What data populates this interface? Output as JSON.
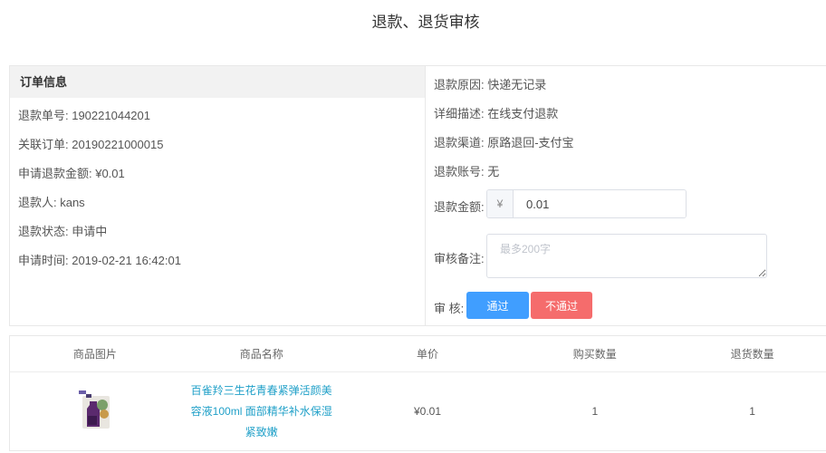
{
  "page": {
    "title": "退款、退货审核"
  },
  "order_info": {
    "header": "订单信息",
    "refund_no": "退款单号: 190221044201",
    "related_order": "关联订单: 20190221000015",
    "apply_amount": "申请退款金额: ¥0.01",
    "refunder": "退款人: kans",
    "status": "退款状态: 申请中",
    "apply_time": "申请时间: 2019-02-21 16:42:01"
  },
  "refund_detail": {
    "reason": "退款原因: 快递无记录",
    "description": "详细描述: 在线支付退款",
    "channel": "退款渠道: 原路退回-支付宝",
    "account": "退款账号: 无",
    "amount_label": "退款金额:",
    "amount_prefix": "¥",
    "amount_value": "0.01",
    "note_label": "审核备注:",
    "note_placeholder": "最多200字",
    "review_label": "审 核:",
    "pass_label": "通过",
    "reject_label": "不通过"
  },
  "goods_table": {
    "headers": [
      "商品图片",
      "商品名称",
      "单价",
      "购买数量",
      "退货数量"
    ],
    "rows": [
      {
        "name": "百雀羚三生花青春紧弹活颜美容液100ml 面部精华补水保湿紧致嫩",
        "price": "¥0.01",
        "buy_qty": "1",
        "return_qty": "1"
      }
    ]
  },
  "colors": {
    "primary": "#409eff",
    "danger": "#f56c6c",
    "link": "#20a0c8"
  }
}
